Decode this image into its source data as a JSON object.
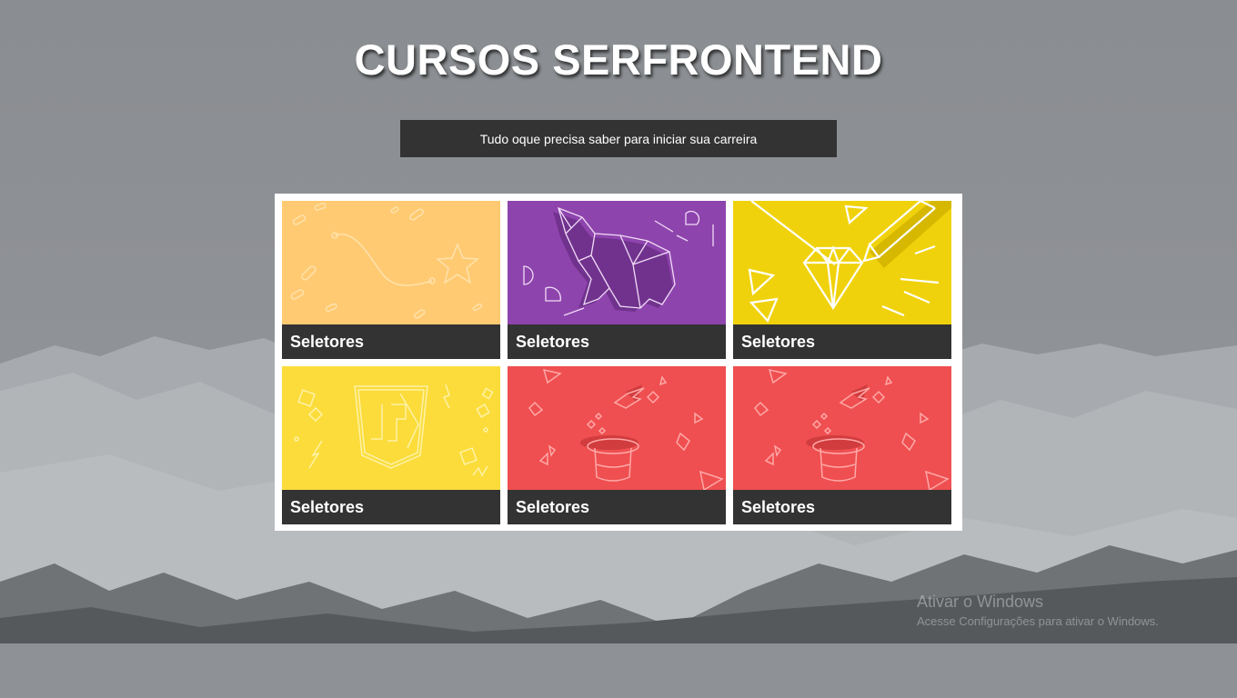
{
  "page": {
    "title": "CURSOS SERFRONTEND",
    "subtitle": "Tudo oque precisa saber para iniciar sua carreira"
  },
  "cards": [
    {
      "label": "Seletores",
      "color": "#ffca72",
      "illustration": "curve-star-icon"
    },
    {
      "label": "Seletores",
      "color": "#8e44ad",
      "illustration": "origami-elephant-icon"
    },
    {
      "label": "Seletores",
      "color": "#f0d20c",
      "illustration": "diamond-pencil-icon"
    },
    {
      "label": "Seletores",
      "color": "#fbdc3a",
      "illustration": "js-shield-icon"
    },
    {
      "label": "Seletores",
      "color": "#ef4f50",
      "illustration": "magic-hat-bird-icon"
    },
    {
      "label": "Seletores",
      "color": "#ef4f50",
      "illustration": "magic-hat-bird-icon"
    }
  ],
  "watermark": {
    "line1": "Ativar o Windows",
    "line2": "Acesse Configurações para ativar o Windows."
  }
}
